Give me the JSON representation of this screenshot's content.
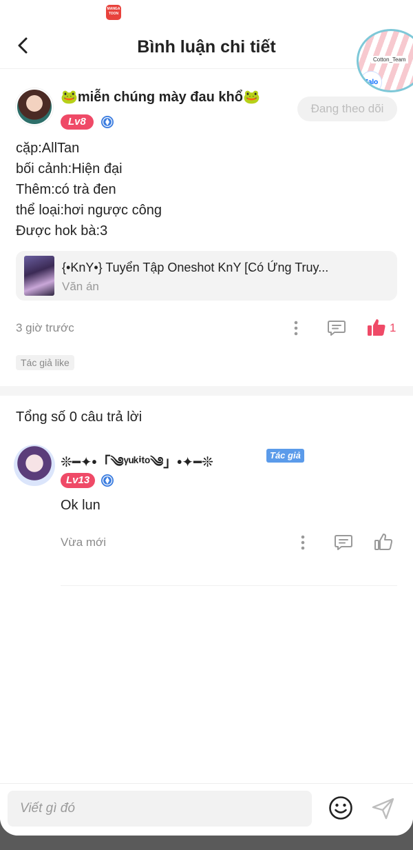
{
  "header": {
    "title": "Bình luận chi tiết",
    "app_badge": "MANGA TOON",
    "floating_tag": "Cotton_Team",
    "floating_zalo": "Zalo"
  },
  "comment": {
    "username": "🐸miễn chúng mày đau khổ🐸",
    "level": "Lv8",
    "follow_label": "Đang theo dõi",
    "lines": [
      "cặp:AllTan",
      "bối cảnh:Hiện đại",
      "Thêm:có trà đen",
      "thể loại:hơi ngược công",
      "Được hok bà:3"
    ],
    "book": {
      "title": "{•KnY•} Tuyển Tập Oneshot KnY [Có Ứng Truy...",
      "subtitle": "Văn án"
    },
    "time": "3 giờ trước",
    "like_count": "1",
    "author_like": "Tác giả like"
  },
  "replies": {
    "count_label": "Tổng số 0 câu trả lời",
    "items": [
      {
        "username": "❊━✦•「༄ᵞᵘᵏⁱᵗᵒ༄」•✦━❊",
        "author_badge": "Tác giả",
        "level": "Lv13",
        "text": "Ok lun",
        "time": "Vừa mới"
      }
    ]
  },
  "bottom": {
    "placeholder": "Viết gì đó"
  },
  "colors": {
    "accent": "#ef4a67",
    "author_badge": "#5b9bea",
    "verify": "#3d7ee0"
  }
}
